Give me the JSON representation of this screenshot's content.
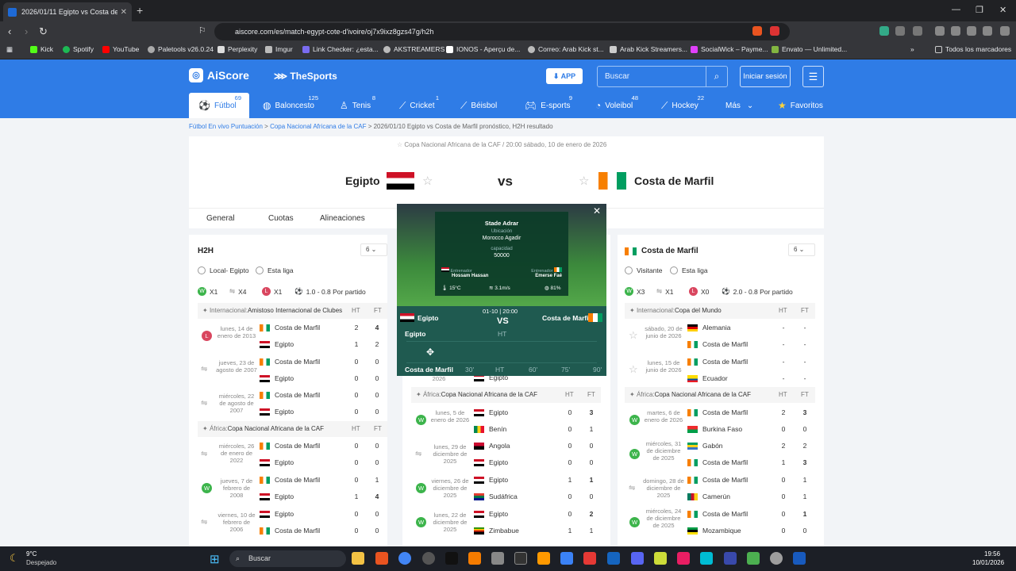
{
  "browser": {
    "tab_title": "2026/01/11 Egipto vs Costa de M",
    "url": "aiscore.com/es/match-egypt-cote-d'ivoire/oj7x9ixz8gzs47g/h2h",
    "bookmarks": [
      "Kick",
      "Spotify",
      "YouTube",
      "Paletools v26.0.24",
      "Perplexity",
      "Imgur",
      "Link Checker: ¿esta...",
      "AKSTREAMERS",
      "IONOS - Aperçu de...",
      "Correo: Arab Kick st...",
      "Arab Kick Streamers...",
      "SocialWick – Payme...",
      "Envato — Unlimited..."
    ],
    "bookmarks_all": "Todos los marcadores"
  },
  "site": {
    "logo": "AiScore",
    "logo2": "TheSports",
    "app_btn": "APP",
    "search_placeholder": "Buscar",
    "login": "Iniciar sesión",
    "sports": [
      {
        "label": "Fútbol",
        "count": "69"
      },
      {
        "label": "Baloncesto",
        "count": "125"
      },
      {
        "label": "Tenis",
        "count": "8"
      },
      {
        "label": "Cricket",
        "count": "1"
      },
      {
        "label": "Béisbol",
        "count": ""
      },
      {
        "label": "E-sports",
        "count": "9"
      },
      {
        "label": "Voleibol",
        "count": "48"
      },
      {
        "label": "Hockey",
        "count": "22"
      },
      {
        "label": "Más",
        "count": ""
      },
      {
        "label": "Favoritos",
        "count": ""
      }
    ]
  },
  "breadcrumb": {
    "a": "Fútbol En vivo Puntuación",
    "b": "Copa Nacional Africana de la CAF",
    "c": "2026/01/10 Egipto vs Costa de Marfil pronóstico, H2H resultado"
  },
  "match": {
    "competition": "Copa Nacional Africana de la CAF",
    "time": "20:00 sábado, 10 de enero de 2026",
    "home": "Egipto",
    "away": "Costa de Marfil",
    "vs": "vs",
    "tabs": [
      "General",
      "Cuotas",
      "Alineaciones"
    ]
  },
  "overlay": {
    "stadium": "Stade Adrar",
    "location_label": "Ubicación",
    "location": "Morocco  Agadir",
    "capacity_label": "capacidad",
    "capacity": "50000",
    "coach_label": "Entrenador",
    "coach_home": "Hossam Hassan",
    "coach_away": "Emerse Faé",
    "temp": "15°C",
    "wind": "3.1m/s",
    "humidity": "81%",
    "home": "Egipto",
    "away": "Costa de Marfil",
    "date": "01-10 | 20:00",
    "vs": "VS",
    "ht": "HT",
    "timeline": [
      "30'",
      "HT",
      "60'",
      "75'",
      "90'"
    ]
  },
  "h2h": {
    "title": "H2H",
    "count": "6",
    "radio1": "Local- Egipto",
    "radio2": "Esta liga",
    "stats": [
      "X1",
      "X4",
      "X1",
      "1.0 - 0.8 Por partido"
    ],
    "group1": {
      "region": "Internacional:",
      "name": "Amistoso Internacional de Clubes",
      "ht": "HT",
      "ft": "FT"
    },
    "group2": {
      "region": "África:",
      "name": "Copa Nacional Africana de la CAF",
      "ht": "HT",
      "ft": "FT"
    },
    "rows": [
      {
        "date": "lunes, 14 de enero de 2013",
        "t1": "Costa de Marfil",
        "t2": "Egipto",
        "ht1": "2",
        "ht2": "1",
        "ft1": "4",
        "ft2": "2",
        "res": "L"
      },
      {
        "date": "jueves, 23 de agosto de 2007",
        "t1": "Costa de Marfil",
        "t2": "Egipto",
        "ht1": "0",
        "ht2": "0",
        "ft1": "0",
        "ft2": "0",
        "res": ""
      },
      {
        "date": "miércoles, 22 de agosto de 2007",
        "t1": "Costa de Marfil",
        "t2": "Egipto",
        "ht1": "0",
        "ht2": "0",
        "ft1": "0",
        "ft2": "0",
        "res": ""
      },
      {
        "date": "miércoles, 26 de enero de 2022",
        "t1": "Costa de Marfil",
        "t2": "Egipto",
        "ht1": "0",
        "ht2": "0",
        "ft1": "0",
        "ft2": "0",
        "res": ""
      },
      {
        "date": "jueves, 7 de febrero de 2008",
        "t1": "Costa de Marfil",
        "t2": "Egipto",
        "ht1": "0",
        "ht2": "1",
        "ft1": "1",
        "ft2": "4",
        "res": "W"
      },
      {
        "date": "viernes, 10 de febrero de 2006",
        "t1": "Egipto",
        "t2": "Costa de Marfil",
        "ht1": "0",
        "ht2": "0",
        "ft1": "0",
        "ft2": "0",
        "res": ""
      }
    ]
  },
  "mid": {
    "partial_team": "Egipto",
    "partial_date": "2026",
    "group": {
      "region": "África:",
      "name": "Copa Nacional Africana de la CAF",
      "ht": "HT",
      "ft": "FT"
    },
    "rows": [
      {
        "date": "lunes, 5 de enero de 2026",
        "t1": "Egipto",
        "t2": "Benín",
        "ht1": "0",
        "ht2": "0",
        "ft1": "3",
        "ft2": "1",
        "res": "W"
      },
      {
        "date": "lunes, 29 de diciembre de 2025",
        "t1": "Angola",
        "t2": "Egipto",
        "ht1": "0",
        "ht2": "0",
        "ft1": "0",
        "ft2": "0",
        "res": ""
      },
      {
        "date": "viernes, 26 de diciembre de 2025",
        "t1": "Egipto",
        "t2": "Sudáfrica",
        "ht1": "1",
        "ht2": "0",
        "ft1": "1",
        "ft2": "0",
        "res": "W"
      },
      {
        "date": "lunes, 22 de diciembre de 2025",
        "t1": "Egipto",
        "t2": "Zimbabue",
        "ht1": "0",
        "ht2": "1",
        "ft1": "2",
        "ft2": "1",
        "res": "W"
      }
    ]
  },
  "right": {
    "title": "Costa de Marfil",
    "count": "6",
    "radio1": "Visitante",
    "radio2": "Esta liga",
    "stats": [
      "X3",
      "X1",
      "X0",
      "2.0 - 0.8 Por partido"
    ],
    "group1": {
      "region": "Internacional:",
      "name": "Copa del Mundo",
      "ht": "HT",
      "ft": "FT"
    },
    "group2": {
      "region": "África:",
      "name": "Copa Nacional Africana de la CAF",
      "ht": "HT",
      "ft": "FT"
    },
    "future": [
      {
        "date": "sábado, 20 de junio de 2026",
        "t1": "Alemania",
        "t2": "Costa de Marfil",
        "ht1": "-",
        "ht2": "-",
        "ft1": "-",
        "ft2": "-"
      },
      {
        "date": "lunes, 15 de junio de 2026",
        "t1": "Costa de Marfil",
        "t2": "Ecuador",
        "ht1": "-",
        "ht2": "-",
        "ft1": "-",
        "ft2": "-"
      }
    ],
    "rows": [
      {
        "date": "martes, 6 de enero de 2026",
        "t1": "Costa de Marfil",
        "t2": "Burkina Faso",
        "ht1": "2",
        "ht2": "0",
        "ft1": "3",
        "ft2": "0",
        "res": "W"
      },
      {
        "date": "miércoles, 31 de diciembre de 2025",
        "t1": "Gabón",
        "t2": "Costa de Marfil",
        "ht1": "2",
        "ht2": "1",
        "ft1": "2",
        "ft2": "3",
        "res": "W"
      },
      {
        "date": "domingo, 28 de diciembre de 2025",
        "t1": "Costa de Marfil",
        "t2": "Camerún",
        "ht1": "0",
        "ht2": "0",
        "ft1": "1",
        "ft2": "1",
        "res": ""
      },
      {
        "date": "miércoles, 24 de diciembre de 2025",
        "t1": "Costa de Marfil",
        "t2": "Mozambique",
        "ht1": "0",
        "ht2": "0",
        "ft1": "1",
        "ft2": "0",
        "res": "W"
      }
    ]
  },
  "taskbar": {
    "temp": "9°C",
    "weather": "Despejado",
    "search": "Buscar",
    "time": "19:56",
    "date": "10/01/2026"
  }
}
